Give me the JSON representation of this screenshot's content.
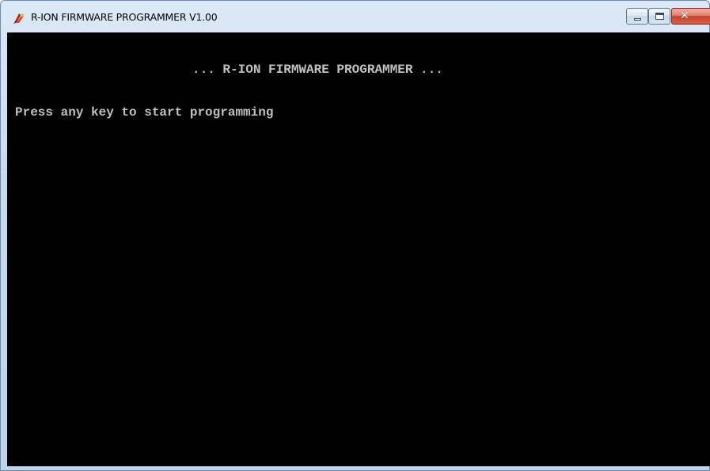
{
  "window": {
    "title": "R-ION FIRMWARE PROGRAMMER V1.00",
    "icon": "app-icon"
  },
  "console": {
    "lines": [
      "... R-ION FIRMWARE PROGRAMMER ...",
      "Press any key to start programming"
    ]
  },
  "colors": {
    "console_background": "#000000",
    "console_text": "#c0c0c0",
    "close_button": "#c7432a"
  }
}
